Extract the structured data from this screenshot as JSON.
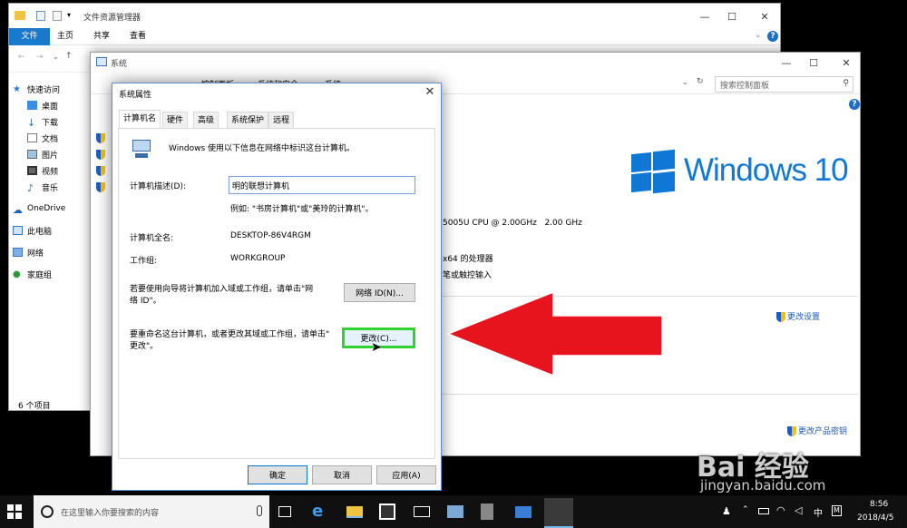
{
  "explorer": {
    "title": "文件资源管理器",
    "ribbon": {
      "file": "文件",
      "home": "主页",
      "share": "共享",
      "view": "查看"
    },
    "nav": [
      {
        "label": "快速访问",
        "icon": "star-icon"
      },
      {
        "label": "桌面",
        "icon": "desktop-icon"
      },
      {
        "label": "下载",
        "icon": "download-icon"
      },
      {
        "label": "文档",
        "icon": "document-icon"
      },
      {
        "label": "图片",
        "icon": "picture-icon"
      },
      {
        "label": "视频",
        "icon": "video-icon"
      },
      {
        "label": "音乐",
        "icon": "music-icon"
      },
      {
        "label": "OneDrive",
        "icon": "cloud-icon"
      },
      {
        "label": "此电脑",
        "icon": "computer-icon"
      },
      {
        "label": "网络",
        "icon": "network-icon"
      },
      {
        "label": "家庭组",
        "icon": "homegroup-icon"
      }
    ],
    "status": "6 个项目"
  },
  "system": {
    "title": "系统",
    "breadcrumb": [
      "控制面板",
      "系统和安全",
      "系统"
    ],
    "search_placeholder": "搜索控制面板",
    "windows_logo_text": "Windows 10",
    "cpu_fragment": "5005U CPU @ 2.00GHz   2.00 GHz",
    "x64_fragment": "x64 的处理器",
    "pen_fragment": "笔或触控输入",
    "change_settings": "更改设置",
    "change_product_key": "更改产品密钥"
  },
  "dialog": {
    "title": "系统属性",
    "tabs": [
      "计算机名",
      "硬件",
      "高级",
      "系统保护",
      "远程"
    ],
    "intro": "Windows 使用以下信息在网络中标识这台计算机。",
    "desc_label": "计算机描述(D):",
    "desc_value": "明的联想计算机",
    "desc_example": "例如: \"书房计算机\"或\"美玲的计算机\"。",
    "fullname_label": "计算机全名:",
    "fullname_value": "DESKTOP-86V4RGM",
    "workgroup_label": "工作组:",
    "workgroup_value": "WORKGROUP",
    "network_text_1": "若要使用向导将计算机加入域或工作组，请单击\"网",
    "network_text_2": "络 ID\"。",
    "network_btn": "网络 ID(N)...",
    "rename_text_1": "要重命名这台计算机，或者更改其域或工作组，请单击\"",
    "rename_text_2": "更改\"。",
    "change_btn": "更改(C)...",
    "ok": "确定",
    "cancel": "取消",
    "apply": "应用(A)"
  },
  "taskbar": {
    "search_placeholder": "在这里输入你要搜索的内容",
    "time": "8:56",
    "date": "2018/4/5",
    "ime": "中"
  },
  "watermark": {
    "brand": "Bai 经验",
    "url": "jingyan.baidu.com"
  },
  "colors": {
    "accent": "#1979ca",
    "highlight": "#2fd32f",
    "arrow": "#e8141d",
    "win_blue": "#0f78d4"
  }
}
